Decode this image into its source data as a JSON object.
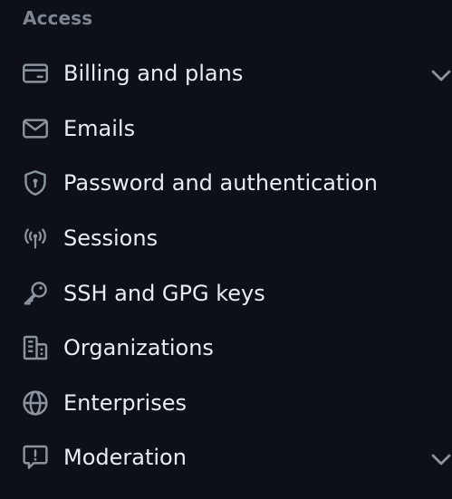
{
  "section": {
    "heading": "Access"
  },
  "items": [
    {
      "label": "Billing and plans",
      "icon": "credit-card-icon",
      "expandable": true
    },
    {
      "label": "Emails",
      "icon": "mail-icon",
      "expandable": false
    },
    {
      "label": "Password and authentication",
      "icon": "shield-lock-icon",
      "expandable": false
    },
    {
      "label": "Sessions",
      "icon": "broadcast-icon",
      "expandable": false
    },
    {
      "label": "SSH and GPG keys",
      "icon": "key-icon",
      "expandable": false
    },
    {
      "label": "Organizations",
      "icon": "organization-icon",
      "expandable": false
    },
    {
      "label": "Enterprises",
      "icon": "globe-icon",
      "expandable": false
    },
    {
      "label": "Moderation",
      "icon": "report-icon",
      "expandable": true
    }
  ],
  "colors": {
    "background": "#0d1117",
    "text": "#e6edf3",
    "muted": "#7d8590",
    "icon": "#8b949e"
  }
}
